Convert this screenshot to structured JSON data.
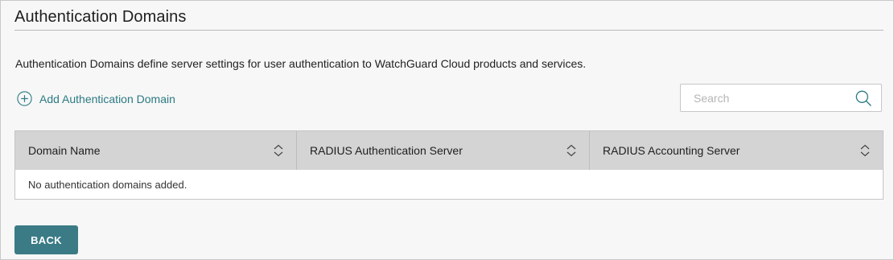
{
  "page": {
    "title": "Authentication Domains",
    "description": "Authentication Domains define server settings for user authentication to WatchGuard Cloud products and services."
  },
  "actions": {
    "add_label": "Add Authentication Domain",
    "add_icon": "plus-circle-icon",
    "back_label": "BACK"
  },
  "search": {
    "placeholder": "Search",
    "value": "",
    "icon": "search-icon"
  },
  "table": {
    "columns": [
      {
        "label": "Domain Name",
        "icon": "sort-icon"
      },
      {
        "label": "RADIUS Authentication Server",
        "icon": "sort-icon"
      },
      {
        "label": "RADIUS Accounting Server",
        "icon": "sort-icon"
      }
    ],
    "rows": [],
    "empty_message": "No authentication domains added."
  },
  "colors": {
    "accent": "#2b7a83",
    "button": "#3a7b86",
    "header_bg": "#d4d4d4",
    "page_bg": "#f7f7f7"
  }
}
